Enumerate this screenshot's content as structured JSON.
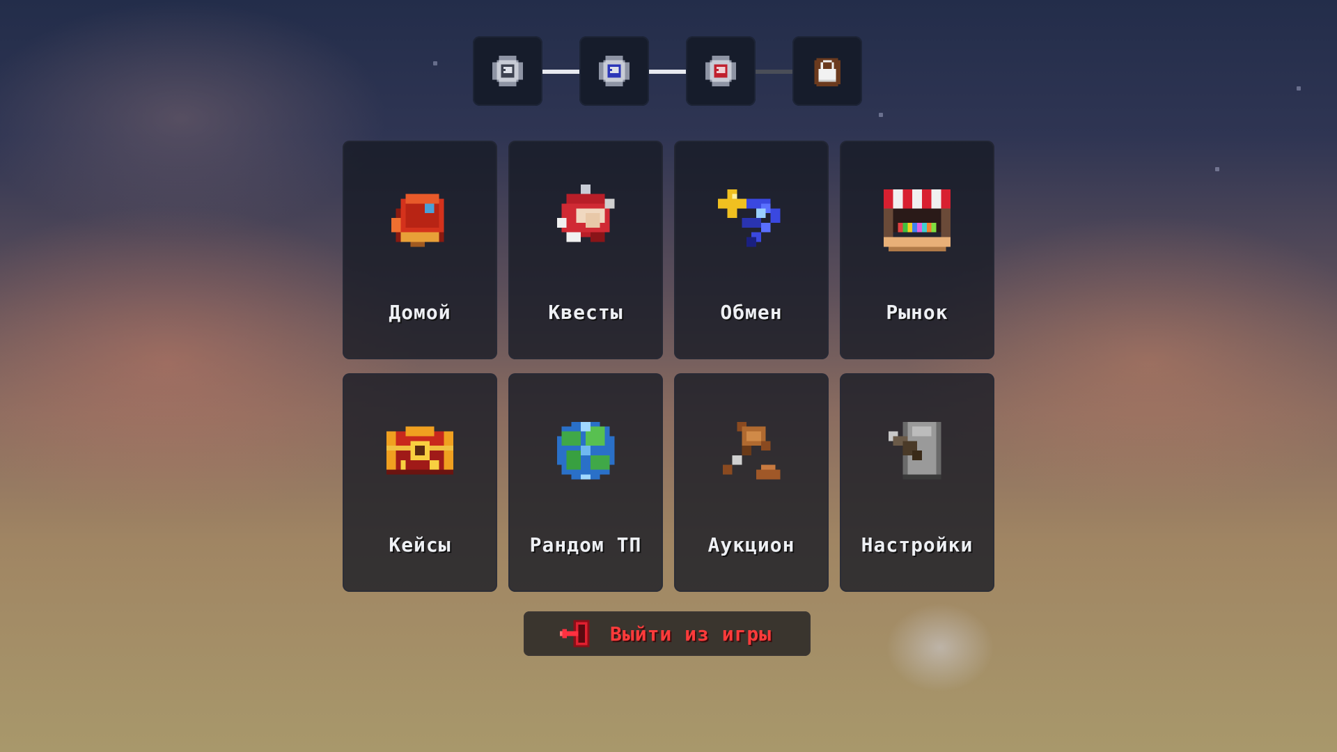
{
  "progress": {
    "nodes": [
      {
        "icon": "rank-silver-icon",
        "color": "#c8ccd6",
        "state": "done"
      },
      {
        "icon": "rank-blue-icon",
        "color": "#3949d8",
        "state": "done"
      },
      {
        "icon": "rank-red-icon",
        "color": "#d22a3a",
        "state": "done"
      },
      {
        "icon": "lock-icon",
        "color": "#f2f2f2",
        "state": "locked"
      }
    ]
  },
  "menu": {
    "items": [
      {
        "label": "Домой",
        "icon": "home-book-icon"
      },
      {
        "label": "Квесты",
        "icon": "quests-scroll-icon"
      },
      {
        "label": "Обмен",
        "icon": "trade-arrows-icon"
      },
      {
        "label": "Рынок",
        "icon": "market-stall-icon"
      },
      {
        "label": "Кейсы",
        "icon": "cases-chest-icon"
      },
      {
        "label": "Рандом ТП",
        "icon": "random-tp-globe-icon"
      },
      {
        "label": "Аукцион",
        "icon": "auction-gavel-icon"
      },
      {
        "label": "Настройки",
        "icon": "settings-anvil-icon"
      }
    ]
  },
  "exit": {
    "label": "Выйти из игры",
    "icon": "exit-door-icon",
    "color": "#ff3b3b"
  }
}
